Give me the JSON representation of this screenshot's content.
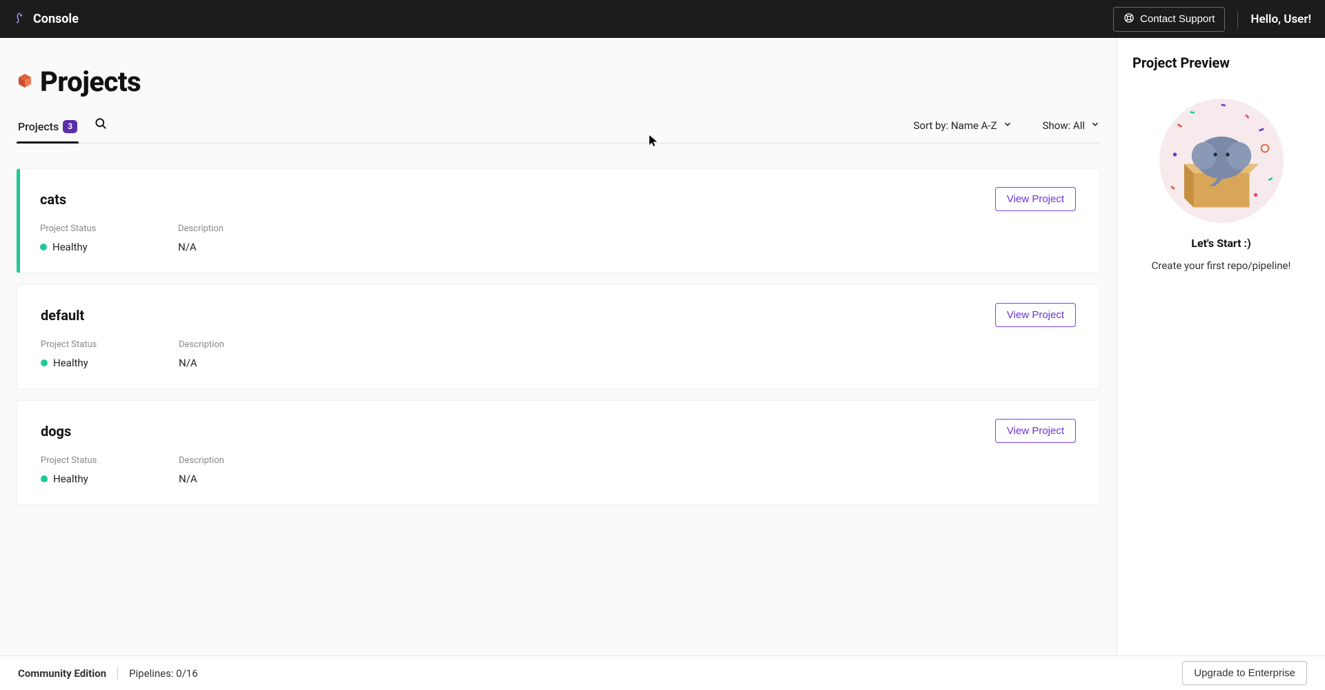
{
  "header": {
    "brand": "Console",
    "support_label": "Contact Support",
    "greeting": "Hello, User!"
  },
  "page": {
    "title": "Projects"
  },
  "tabs": {
    "projects_label": "Projects",
    "projects_count": "3"
  },
  "controls": {
    "sort_label": "Sort by: Name A-Z",
    "show_label": "Show: All"
  },
  "meta_labels": {
    "status": "Project Status",
    "description": "Description"
  },
  "view_button_label": "View  Project",
  "projects": [
    {
      "name": "cats",
      "status": "Healthy",
      "description": "N/A",
      "selected": true
    },
    {
      "name": "default",
      "status": "Healthy",
      "description": "N/A",
      "selected": false
    },
    {
      "name": "dogs",
      "status": "Healthy",
      "description": "N/A",
      "selected": false
    }
  ],
  "sidebar": {
    "heading": "Project Preview",
    "title": "Let's Start :)",
    "caption": "Create your first repo/pipeline!"
  },
  "footer": {
    "edition": "Community Edition",
    "pipelines": "Pipelines: 0/16",
    "upgrade_label": "Upgrade to Enterprise"
  },
  "colors": {
    "accent_purple": "#6933db",
    "accent_green": "#1ec997"
  }
}
